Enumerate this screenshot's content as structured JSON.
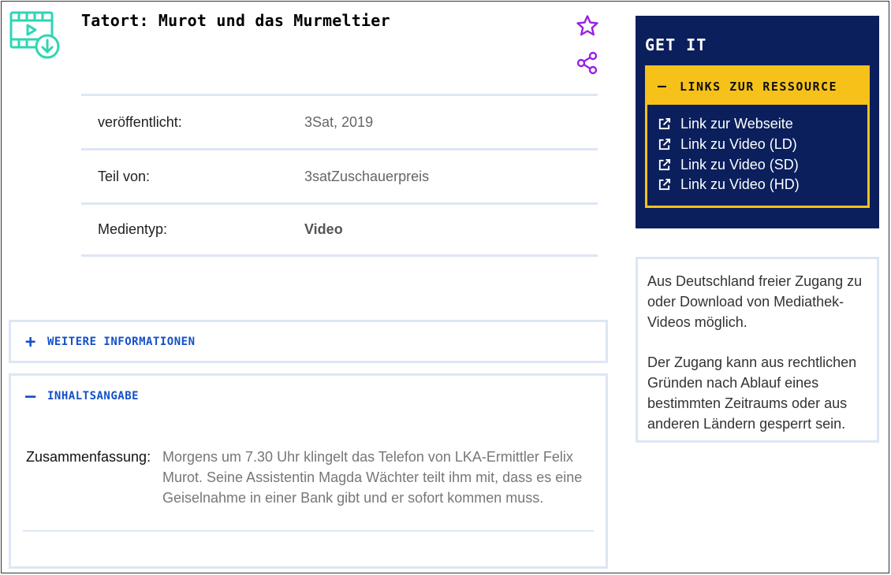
{
  "header": {
    "title": "Tatort: Murot und das Murmeltier",
    "media_icon": "video-download-icon",
    "favorite_icon": "star-icon",
    "share_icon": "share-icon"
  },
  "metadata": [
    {
      "key": "veröffentlicht:",
      "value": "3Sat, 2019",
      "bold": false
    },
    {
      "key": "Teil von:",
      "value": "3satZuschauerpreis",
      "bold": false
    },
    {
      "key": "Medientyp:",
      "value": "Video",
      "bold": true
    }
  ],
  "panels": {
    "more_info": {
      "symbol": "+",
      "label": "WEITERE INFORMATIONEN",
      "expanded": false
    },
    "summary": {
      "symbol": "—",
      "label": "INHALTSANGABE",
      "expanded": true,
      "key": "Zusammenfassung:",
      "value": "Morgens um 7.30 Uhr klingelt das Telefon von LKA-Ermittler Felix Murot. Seine Assistentin Magda Wächter teilt ihm mit, dass es eine Geiselnahme in einer Bank gibt und er sofort kommen muss."
    }
  },
  "get_it": {
    "title": "GET IT",
    "resource_symbol": "—",
    "resource_label": "LINKS ZUR RESSOURCE",
    "links": [
      {
        "label": "Link zur Webseite",
        "icon": "external-link-icon"
      },
      {
        "label": "Link zu Video (LD)",
        "icon": "external-link-icon"
      },
      {
        "label": "Link zu Video (SD)",
        "icon": "external-link-icon"
      },
      {
        "label": "Link zu Video (HD)",
        "icon": "external-link-icon"
      }
    ]
  },
  "access_info": {
    "paragraph1": "Aus Deutschland freier Zugang zu oder Download von Mediathek-Videos möglich.",
    "paragraph2": "Der Zugang kann aus rechtlichen Gründen nach Ablauf eines bestimmten Zeitraums oder aus anderen Ländern gesperrt sein."
  },
  "colors": {
    "accent_teal": "#2ed6b4",
    "accent_purple": "#9b1fe0",
    "link_blue": "#1450c8",
    "navy": "#0b1f5c",
    "yellow": "#f6c21a",
    "border_light": "#dde6f4"
  }
}
